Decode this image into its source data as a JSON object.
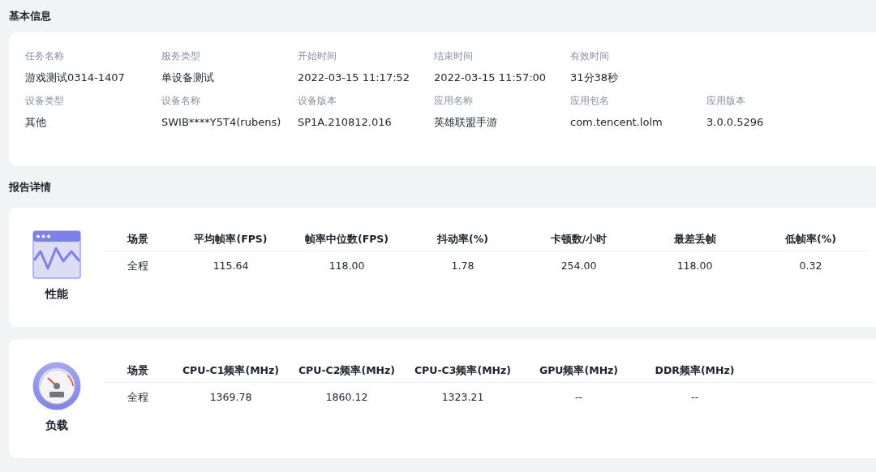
{
  "basic_info": {
    "title": "基本信息",
    "rows": [
      [
        {
          "label": "任务名称",
          "value": "游戏测试0314-1407"
        },
        {
          "label": "服务类型",
          "value": "单设备测试"
        },
        {
          "label": "开始时间",
          "value": "2022-03-15 11:17:52"
        },
        {
          "label": "结束时间",
          "value": "2022-03-15 11:57:00"
        },
        {
          "label": "有效时间",
          "value": "31分38秒"
        }
      ],
      [
        {
          "label": "设备类型",
          "value": "其他"
        },
        {
          "label": "设备名称",
          "value": "SWIB****Y5T4(rubens)"
        },
        {
          "label": "设备版本",
          "value": "SP1A.210812.016"
        },
        {
          "label": "应用名称",
          "value": "英雄联盟手游"
        },
        {
          "label": "应用包名",
          "value": "com.tencent.lolm"
        },
        {
          "label": "应用版本",
          "value": "3.0.0.5296"
        }
      ]
    ]
  },
  "report": {
    "title": "报告详情",
    "sections": [
      {
        "kind": "performance",
        "name": "性能",
        "columns": [
          "场景",
          "平均帧率(FPS)",
          "帧率中位数(FPS)",
          "抖动率(%)",
          "卡顿数/小时",
          "最差丢帧",
          "低帧率(%)"
        ],
        "rows": [
          [
            "全程",
            "115.64",
            "118.00",
            "1.78",
            "254.00",
            "118.00",
            "0.32"
          ]
        ]
      },
      {
        "kind": "load",
        "name": "负载",
        "columns": [
          "场景",
          "CPU-C1频率(MHz)",
          "CPU-C2频率(MHz)",
          "CPU-C3频率(MHz)",
          "GPU频率(MHz)",
          "DDR频率(MHz)"
        ],
        "rows": [
          [
            "全程",
            "1369.78",
            "1860.12",
            "1323.21",
            "--",
            "--"
          ]
        ]
      }
    ]
  }
}
